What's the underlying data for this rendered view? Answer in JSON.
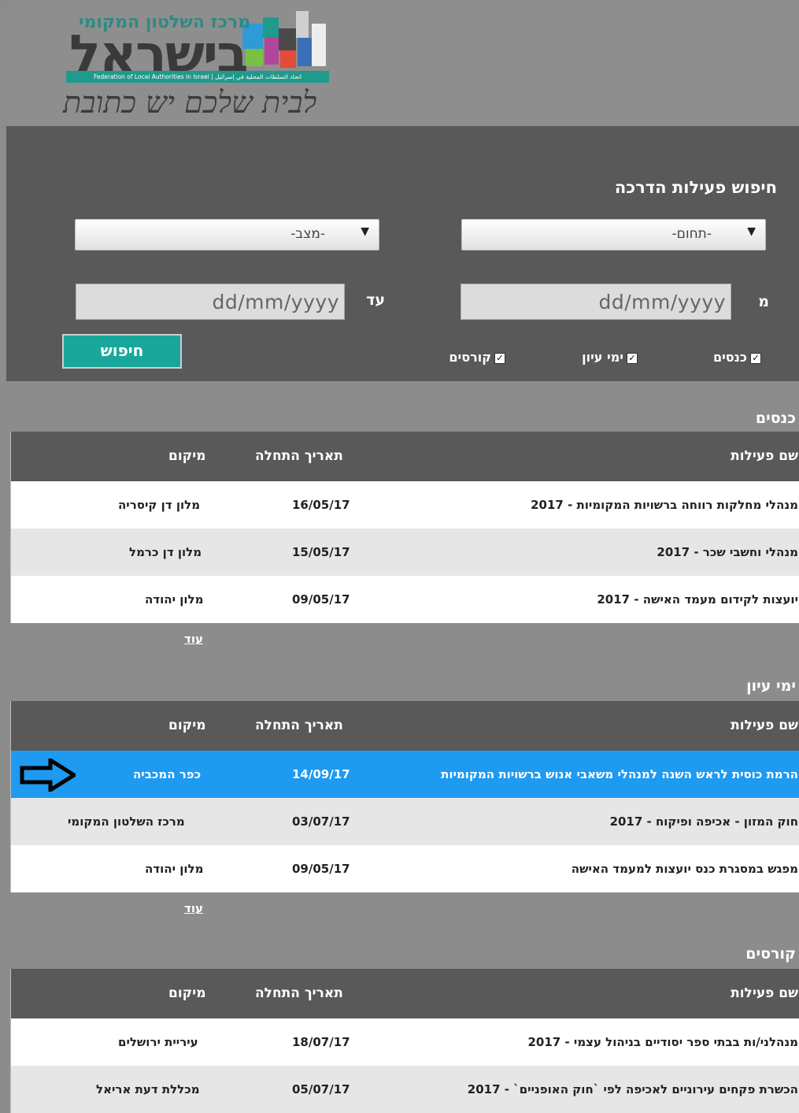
{
  "header": {
    "logo_top": "מרכז השלטון המקומי",
    "logo_main": "בישראל",
    "logo_strip": "Federation of Local Authorities in Israel | اتحاد السلطات المحلية في إسرائيل",
    "logo_slogan": "לבית שלכם יש כתובת"
  },
  "search": {
    "title": "חיפוש פעילות הדרכה",
    "domain_select": "-תחום-",
    "status_select": "-מצב-",
    "from_label": "מ",
    "to_label": "עד",
    "date_placeholder": "dd/mm/yyyy",
    "checks": [
      {
        "label": "כנסים",
        "checked": true
      },
      {
        "label": "ימי עיון",
        "checked": true
      },
      {
        "label": "קורסים",
        "checked": true
      }
    ],
    "button": "חיפוש"
  },
  "sections": [
    {
      "title": "כנסים",
      "headers": {
        "name": "שם פעילות",
        "date": "תאריך התחלה",
        "location": "מיקום"
      },
      "rows": [
        {
          "name": "מנהלי מחלקות רווחה ברשויות המקומיות - 2017",
          "date": "16/05/17",
          "location": "מלון דן קיסריה"
        },
        {
          "name": "מנהלי וחשבי שכר - 2017",
          "date": "15/05/17",
          "location": "מלון דן כרמל"
        },
        {
          "name": "יועצות לקידום מעמד האישה - 2017",
          "date": "09/05/17",
          "location": "מלון יהודה"
        }
      ],
      "more": "עוד"
    },
    {
      "title": "ימי עיון",
      "headers": {
        "name": "שם פעילות",
        "date": "תאריך התחלה",
        "location": "מיקום"
      },
      "rows": [
        {
          "name": "הרמת כוסית לראש השנה למנהלי משאבי אנוש ברשויות המקומיות",
          "date": "14/09/17",
          "location": "כפר המכביה"
        },
        {
          "name": "חוק המזון - אכיפה ופיקוח - 2017",
          "date": "03/07/17",
          "location": "מרכז השלטון המקומי"
        },
        {
          "name": "מפגש במסגרת כנס יועצות למעמד האישה",
          "date": "09/05/17",
          "location": "מלון יהודה"
        }
      ],
      "more": "עוד"
    },
    {
      "title": "קורסים",
      "headers": {
        "name": "שם פעילות",
        "date": "תאריך התחלה",
        "location": "מיקום"
      },
      "rows": [
        {
          "name": "מנהלני/ות בבתי ספר יסודיים בניהול עצמי - 2017",
          "date": "18/07/17",
          "location": "עיריית ירושלים"
        },
        {
          "name": "הכשרת פקחים עירוניים לאכיפה לפי `חוק האופניים` - 2017",
          "date": "05/07/17",
          "location": "מכללת דעת אריאל"
        }
      ]
    }
  ],
  "colors": {
    "accent": "#1aa79b",
    "highlight": "#1e9af0",
    "panel": "#595959",
    "background": "#8c8c8c"
  }
}
